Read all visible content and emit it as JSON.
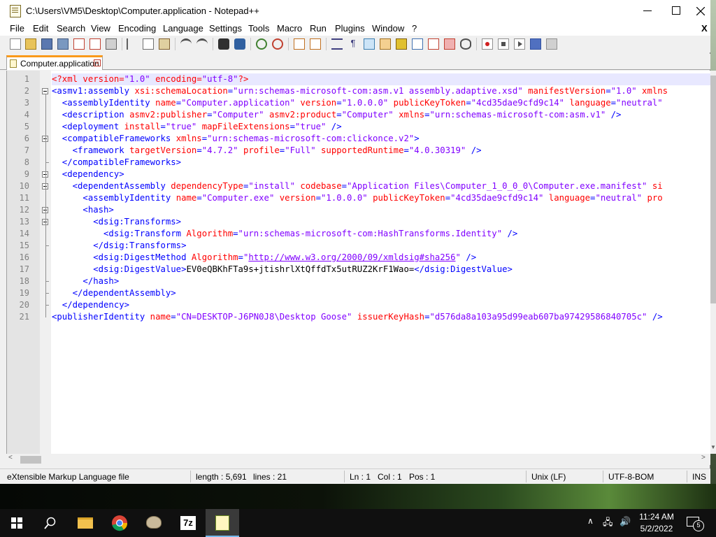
{
  "window": {
    "title": "C:\\Users\\VM5\\Desktop\\Computer.application - Notepad++"
  },
  "menu": [
    "File",
    "Edit",
    "Search",
    "View",
    "Encoding",
    "Language",
    "Settings",
    "Tools",
    "Macro",
    "Run",
    "Plugins",
    "Window",
    "?"
  ],
  "menu_close": "X",
  "tab": {
    "label": "Computer.application",
    "close_glyph": "×"
  },
  "editor": {
    "line_numbers": [
      "1",
      "2",
      "3",
      "4",
      "5",
      "6",
      "7",
      "8",
      "9",
      "10",
      "11",
      "12",
      "13",
      "14",
      "15",
      "16",
      "17",
      "18",
      "19",
      "20",
      "21"
    ],
    "lines": [
      [
        [
          "pi",
          "<?xml "
        ],
        [
          "attr",
          "version"
        ],
        [
          "pi",
          "="
        ],
        [
          "val",
          "\"1.0\""
        ],
        [
          "pi",
          " "
        ],
        [
          "attr",
          "encoding"
        ],
        [
          "pi",
          "="
        ],
        [
          "val",
          "\"utf-8\""
        ],
        [
          "pi",
          "?>"
        ]
      ],
      [
        [
          "tag",
          "<asmv1:assembly "
        ],
        [
          "attr",
          "xsi:schemaLocation"
        ],
        [
          "tag",
          "="
        ],
        [
          "val",
          "\"urn:schemas-microsoft-com:asm.v1 assembly.adaptive.xsd\""
        ],
        [
          "tag",
          " "
        ],
        [
          "attr",
          "manifestVersion"
        ],
        [
          "tag",
          "="
        ],
        [
          "val",
          "\"1.0\""
        ],
        [
          "tag",
          " "
        ],
        [
          "attr",
          "xmlns"
        ]
      ],
      [
        [
          "tag",
          "  <assemblyIdentity "
        ],
        [
          "attr",
          "name"
        ],
        [
          "tag",
          "="
        ],
        [
          "val",
          "\"Computer.application\""
        ],
        [
          "tag",
          " "
        ],
        [
          "attr",
          "version"
        ],
        [
          "tag",
          "="
        ],
        [
          "val",
          "\"1.0.0.0\""
        ],
        [
          "tag",
          " "
        ],
        [
          "attr",
          "publicKeyToken"
        ],
        [
          "tag",
          "="
        ],
        [
          "val",
          "\"4cd35dae9cfd9c14\""
        ],
        [
          "tag",
          " "
        ],
        [
          "attr",
          "language"
        ],
        [
          "tag",
          "="
        ],
        [
          "val",
          "\"neutral\""
        ]
      ],
      [
        [
          "tag",
          "  <description "
        ],
        [
          "attr",
          "asmv2:publisher"
        ],
        [
          "tag",
          "="
        ],
        [
          "val",
          "\"Computer\""
        ],
        [
          "tag",
          " "
        ],
        [
          "attr",
          "asmv2:product"
        ],
        [
          "tag",
          "="
        ],
        [
          "val",
          "\"Computer\""
        ],
        [
          "tag",
          " "
        ],
        [
          "attr",
          "xmlns"
        ],
        [
          "tag",
          "="
        ],
        [
          "val",
          "\"urn:schemas-microsoft-com:asm.v1\""
        ],
        [
          "tag",
          " />"
        ]
      ],
      [
        [
          "tag",
          "  <deployment "
        ],
        [
          "attr",
          "install"
        ],
        [
          "tag",
          "="
        ],
        [
          "val",
          "\"true\""
        ],
        [
          "tag",
          " "
        ],
        [
          "attr",
          "mapFileExtensions"
        ],
        [
          "tag",
          "="
        ],
        [
          "val",
          "\"true\""
        ],
        [
          "tag",
          " />"
        ]
      ],
      [
        [
          "tag",
          "  <compatibleFrameworks "
        ],
        [
          "attr",
          "xmlns"
        ],
        [
          "tag",
          "="
        ],
        [
          "val",
          "\"urn:schemas-microsoft-com:clickonce.v2\""
        ],
        [
          "tag",
          ">"
        ]
      ],
      [
        [
          "tag",
          "    <framework "
        ],
        [
          "attr",
          "targetVersion"
        ],
        [
          "tag",
          "="
        ],
        [
          "val",
          "\"4.7.2\""
        ],
        [
          "tag",
          " "
        ],
        [
          "attr",
          "profile"
        ],
        [
          "tag",
          "="
        ],
        [
          "val",
          "\"Full\""
        ],
        [
          "tag",
          " "
        ],
        [
          "attr",
          "supportedRuntime"
        ],
        [
          "tag",
          "="
        ],
        [
          "val",
          "\"4.0.30319\""
        ],
        [
          "tag",
          " />"
        ]
      ],
      [
        [
          "tag",
          "  </compatibleFrameworks>"
        ]
      ],
      [
        [
          "tag",
          "  <dependency>"
        ]
      ],
      [
        [
          "tag",
          "    <dependentAssembly "
        ],
        [
          "attr",
          "dependencyType"
        ],
        [
          "tag",
          "="
        ],
        [
          "val",
          "\"install\""
        ],
        [
          "tag",
          " "
        ],
        [
          "attr",
          "codebase"
        ],
        [
          "tag",
          "="
        ],
        [
          "val",
          "\"Application Files\\Computer_1_0_0_0\\Computer.exe.manifest\""
        ],
        [
          "tag",
          " "
        ],
        [
          "attr",
          "si"
        ]
      ],
      [
        [
          "tag",
          "      <assemblyIdentity "
        ],
        [
          "attr",
          "name"
        ],
        [
          "tag",
          "="
        ],
        [
          "val",
          "\"Computer.exe\""
        ],
        [
          "tag",
          " "
        ],
        [
          "attr",
          "version"
        ],
        [
          "tag",
          "="
        ],
        [
          "val",
          "\"1.0.0.0\""
        ],
        [
          "tag",
          " "
        ],
        [
          "attr",
          "publicKeyToken"
        ],
        [
          "tag",
          "="
        ],
        [
          "val",
          "\"4cd35dae9cfd9c14\""
        ],
        [
          "tag",
          " "
        ],
        [
          "attr",
          "language"
        ],
        [
          "tag",
          "="
        ],
        [
          "val",
          "\"neutral\""
        ],
        [
          "tag",
          " "
        ],
        [
          "attr",
          "pro"
        ]
      ],
      [
        [
          "tag",
          "      <hash>"
        ]
      ],
      [
        [
          "tag",
          "        <dsig:Transforms>"
        ]
      ],
      [
        [
          "tag",
          "          <dsig:Transform "
        ],
        [
          "attr",
          "Algorithm"
        ],
        [
          "tag",
          "="
        ],
        [
          "val",
          "\"urn:schemas-microsoft-com:HashTransforms.Identity\""
        ],
        [
          "tag",
          " />"
        ]
      ],
      [
        [
          "tag",
          "        </dsig:Transforms>"
        ]
      ],
      [
        [
          "tag",
          "        <dsig:DigestMethod "
        ],
        [
          "attr",
          "Algorithm"
        ],
        [
          "tag",
          "="
        ],
        [
          "val",
          "\""
        ],
        [
          "link",
          "http://www.w3.org/2000/09/xmldsig#sha256"
        ],
        [
          "val",
          "\""
        ],
        [
          "tag",
          " />"
        ]
      ],
      [
        [
          "tag",
          "        <dsig:DigestValue>"
        ],
        [
          "text",
          "EV0eQBKhFTa9s+jtishrlXtQffdTx5utRUZ2KrF1Wao="
        ],
        [
          "tag",
          "</dsig:DigestValue>"
        ]
      ],
      [
        [
          "tag",
          "      </hash>"
        ]
      ],
      [
        [
          "tag",
          "    </dependentAssembly>"
        ]
      ],
      [
        [
          "tag",
          "  </dependency>"
        ]
      ],
      [
        [
          "tag",
          "<publisherIdentity "
        ],
        [
          "attr",
          "name"
        ],
        [
          "tag",
          "="
        ],
        [
          "val",
          "\"CN=DESKTOP-J6PN0J8\\Desktop Goose\""
        ],
        [
          "tag",
          " "
        ],
        [
          "attr",
          "issuerKeyHash"
        ],
        [
          "tag",
          "="
        ],
        [
          "val",
          "\"d576da8a103a95d99eab607ba97429586840705c\""
        ],
        [
          "tag",
          " />"
        ]
      ]
    ]
  },
  "status": {
    "file_type": "eXtensible Markup Language file",
    "length": "length : 5,691",
    "lines": "lines : 21",
    "ln": "Ln : 1",
    "col": "Col : 1",
    "pos": "Pos : 1",
    "eol": "Unix (LF)",
    "encoding": "UTF-8-BOM",
    "mode": "INS"
  },
  "taskbar": {
    "time": "11:24 AM",
    "date": "5/2/2022",
    "notification_count": "5",
    "apps": [
      "windows-start-icon",
      "search-icon",
      "file-explorer-icon",
      "chrome-icon",
      "paint-icon",
      "7zip-icon",
      "notepadpp-icon"
    ]
  }
}
